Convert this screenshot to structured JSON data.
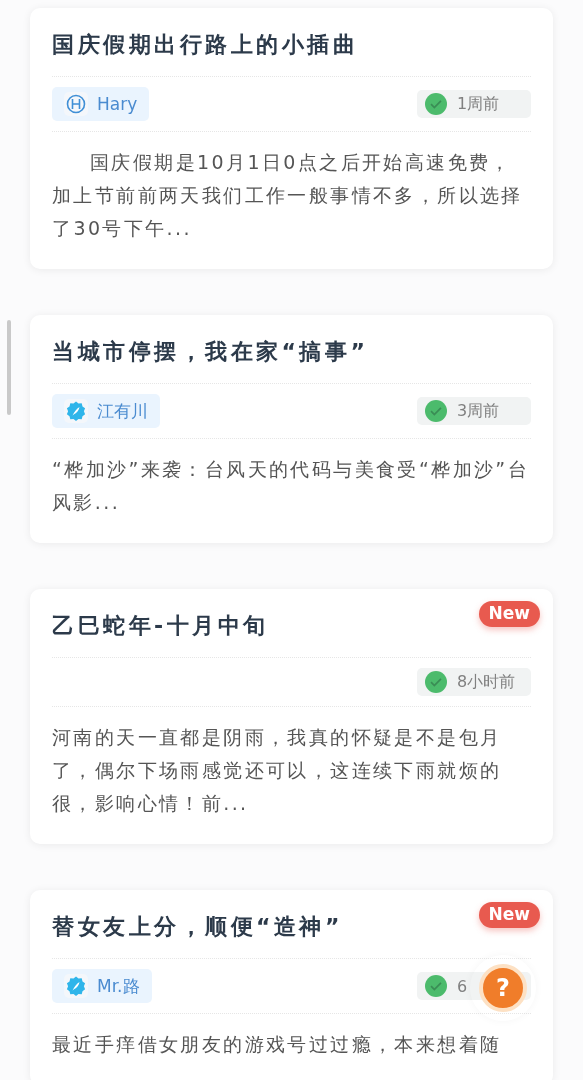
{
  "posts": [
    {
      "title": "国庆假期出行路上的小插曲",
      "is_new": false,
      "author": {
        "name": "Hary",
        "kind": "h-logo"
      },
      "time": "1周前",
      "excerpt": "国庆假期是10月1日0点之后开始高速免费，加上节前前两天我们工作一般事情不多，所以选择了30号下午...",
      "indent": true
    },
    {
      "title": "当城市停摆，我在家“搞事”",
      "is_new": false,
      "author": {
        "name": "江有川",
        "kind": "feather"
      },
      "time": "3周前",
      "excerpt": "“桦加沙”来袭：台风天的代码与美食受“桦加沙”台风影...",
      "indent": false
    },
    {
      "title": "乙巳蛇年-十月中旬",
      "is_new": true,
      "new_label": "New",
      "time": "8小时前",
      "excerpt": "河南的天一直都是阴雨，我真的怀疑是不是包月了，偶尔下场雨感觉还可以，这连续下雨就烦的很，影响心情！前...",
      "indent": false
    },
    {
      "title": "替女友上分，顺便“造神”",
      "is_new": true,
      "new_label": "New",
      "author": {
        "name": "Mr.路",
        "kind": "feather"
      },
      "time": "6",
      "excerpt": "最近手痒借女朋友的游戏号过过瘾，本来想着随",
      "indent": false
    }
  ],
  "help_button": {
    "label": "?"
  }
}
